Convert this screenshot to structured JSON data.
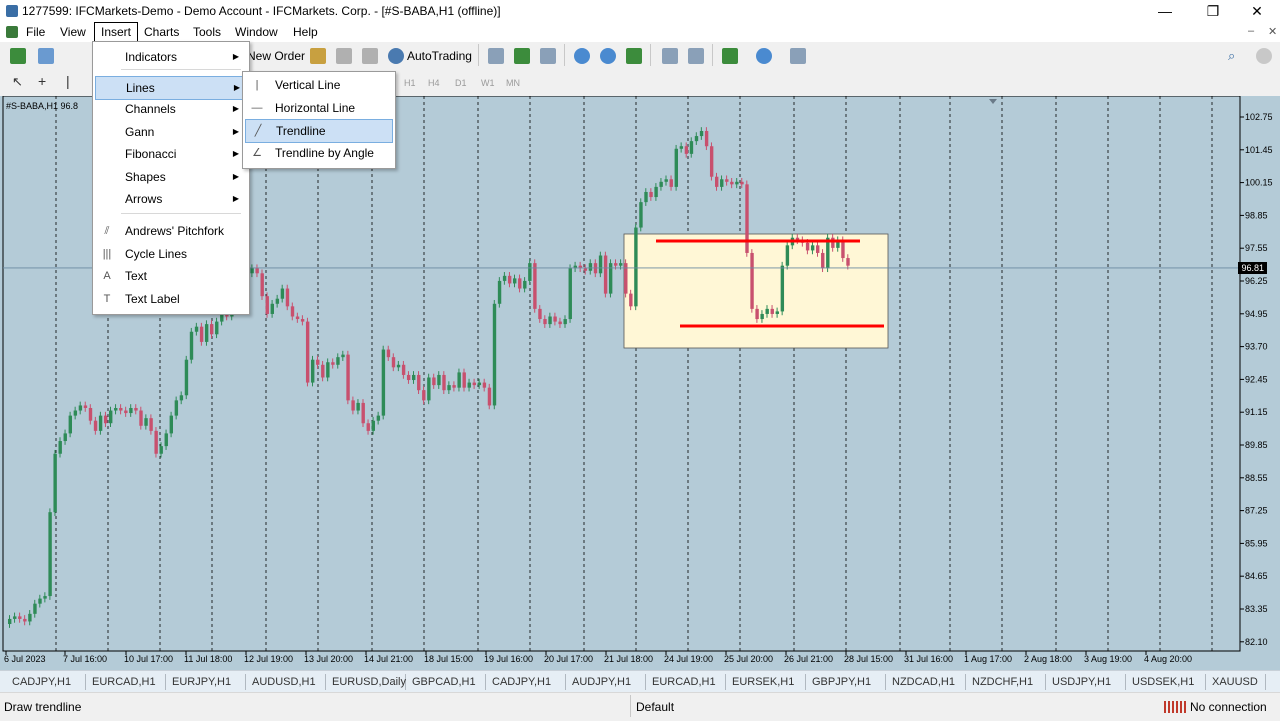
{
  "window": {
    "title": "1277599: IFCMarkets-Demo - Demo Account - IFCMarkets. Corp. - [#S-BABA,H1 (offline)]",
    "minimize": "—",
    "restore": "❐",
    "close": "✕"
  },
  "menubar": [
    "File",
    "View",
    "Insert",
    "Charts",
    "Tools",
    "Window",
    "Help"
  ],
  "toolbar": {
    "new_order": "New Order",
    "autotrading": "AutoTrading",
    "timeframes": [
      "H1",
      "H4",
      "D1",
      "W1",
      "MN"
    ]
  },
  "insert_menu": {
    "items": [
      {
        "label": "Indicators",
        "submenu": true
      },
      {
        "label": "Lines",
        "submenu": true
      },
      {
        "label": "Channels",
        "submenu": true
      },
      {
        "label": "Gann",
        "submenu": true
      },
      {
        "label": "Fibonacci",
        "submenu": true
      },
      {
        "label": "Shapes",
        "submenu": true
      },
      {
        "label": "Arrows",
        "submenu": true
      },
      {
        "label": "Andrews' Pitchfork",
        "icon": "pitchfork-icon"
      },
      {
        "label": "Cycle Lines",
        "icon": "cycle-lines-icon"
      },
      {
        "label": "Text",
        "icon": "text-icon"
      },
      {
        "label": "Text Label",
        "icon": "text-label-icon"
      }
    ]
  },
  "lines_submenu": {
    "items": [
      {
        "label": "Vertical Line",
        "icon": "vertical-line-icon"
      },
      {
        "label": "Horizontal Line",
        "icon": "horizontal-line-icon"
      },
      {
        "label": "Trendline",
        "icon": "trendline-icon",
        "highlighted": true
      },
      {
        "label": "Trendline by Angle",
        "icon": "trendline-angle-icon"
      }
    ]
  },
  "chart": {
    "label": "#S-BABA,H1  96.8",
    "current_price": "96.81",
    "price_axis": [
      "102.75",
      "101.45",
      "100.15",
      "98.85",
      "97.55",
      "96.25",
      "94.95",
      "93.70",
      "92.45",
      "91.15",
      "89.85",
      "88.55",
      "87.25",
      "85.95",
      "84.65",
      "83.35",
      "82.10"
    ],
    "time_axis": [
      "6 Jul 2023",
      "7 Jul 16:00",
      "10 Jul 17:00",
      "11 Jul 18:00",
      "12 Jul 19:00",
      "13 Jul 20:00",
      "14 Jul 21:00",
      "18 Jul 15:00",
      "19 Jul 16:00",
      "20 Jul 17:00",
      "21 Jul 18:00",
      "24 Jul 19:00",
      "25 Jul 20:00",
      "26 Jul 21:00",
      "28 Jul 15:00",
      "31 Jul 16:00",
      "1 Aug 17:00",
      "2 Aug 18:00",
      "3 Aug 19:00",
      "4 Aug 20:00"
    ],
    "colors": {
      "background": "#b4cbd7",
      "bull": "#2e8b57",
      "bear": "#c8506e",
      "annotation": "#ff0000",
      "box": "#fff7d6"
    }
  },
  "symbol_tabs": [
    "CADJPY,H1",
    "EURCAD,H1",
    "EURJPY,H1",
    "AUDUSD,H1",
    "EURUSD,Daily",
    "GBPCAD,H1",
    "CADJPY,H1",
    "AUDJPY,H1",
    "EURCAD,H1",
    "EURSEK,H1",
    "GBPJPY,H1",
    "NZDCAD,H1",
    "NZDCHF,H1",
    "USDJPY,H1",
    "USDSEK,H1",
    "XAUUSD"
  ],
  "statusbar": {
    "hint": "Draw trendline",
    "profile": "Default",
    "connection": "No connection"
  }
}
